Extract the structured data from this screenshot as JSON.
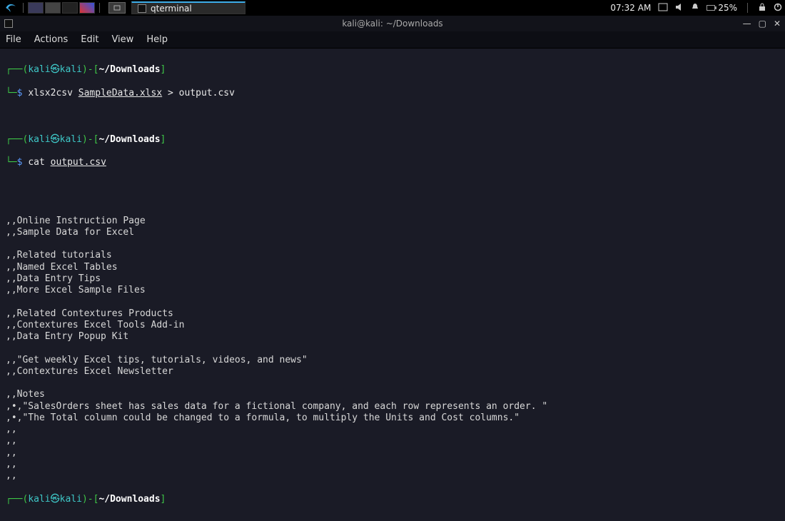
{
  "panel": {
    "task_app": "qterminal",
    "clock": "07:32 AM",
    "battery_pct": "25%"
  },
  "window": {
    "title": "kali@kali: ~/Downloads"
  },
  "menubar": {
    "file": "File",
    "actions": "Actions",
    "edit": "Edit",
    "view": "View",
    "help": "Help"
  },
  "prompt": {
    "open": "┌──(",
    "user": "kali",
    "at": "㉿",
    "host": "kali",
    "close_user": ")-[",
    "path": "~/Downloads",
    "close_path": "]",
    "ps2": "└─",
    "dollar": "$"
  },
  "cmds": {
    "c1_bin": "xlsx2csv",
    "c1_arg": "SampleData.xlsx",
    "c1_redir": "> output.csv",
    "c2_bin": "cat",
    "c2_arg": "output.csv"
  },
  "output_lines": [
    "",
    "",
    "",
    ",,Online Instruction Page",
    ",,Sample Data for Excel",
    "",
    ",,Related tutorials",
    ",,Named Excel Tables",
    ",,Data Entry Tips",
    ",,More Excel Sample Files",
    "",
    ",,Related Contextures Products",
    ",,Contextures Excel Tools Add-in",
    ",,Data Entry Popup Kit",
    "",
    ",,\"Get weekly Excel tips, tutorials, videos, and news\"",
    ",,Contextures Excel Newsletter",
    "",
    ",,Notes",
    ",•,\"SalesOrders sheet has sales data for a fictional company, and each row represents an order. \"",
    ",•,\"The Total column could be changed to a formula, to multiply the Units and Cost columns.\"",
    ",,",
    ",,",
    ",,",
    ",,",
    ",,",
    ""
  ]
}
